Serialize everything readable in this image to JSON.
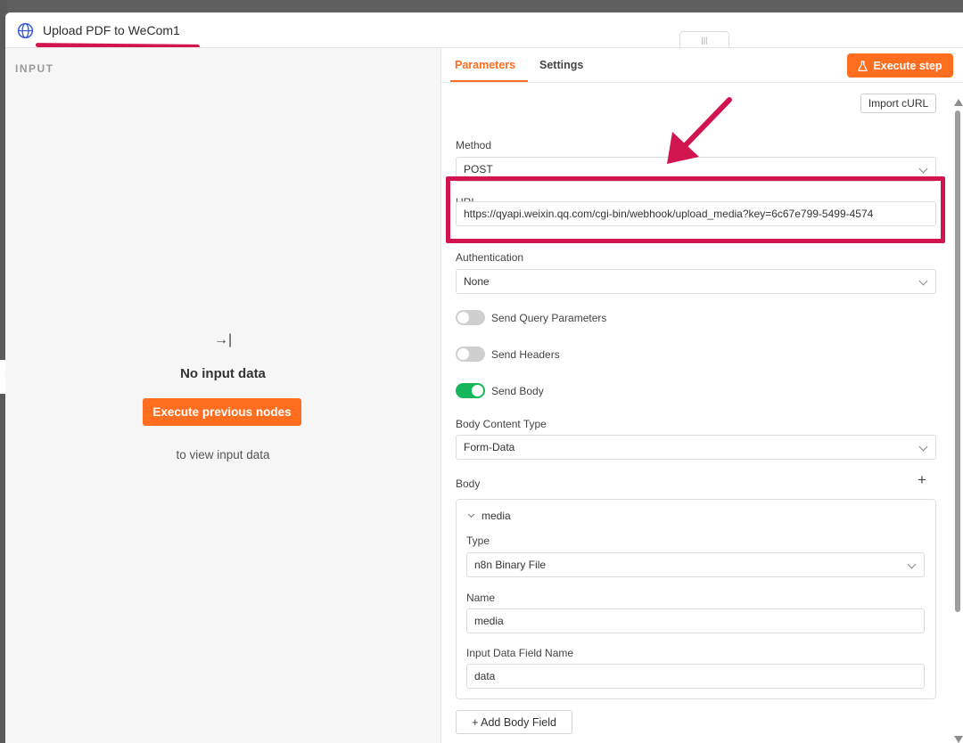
{
  "window": {
    "title": "Upload PDF to WeCom1",
    "handle_glyph": "|||"
  },
  "backdrop": {
    "tab_text": "{ }"
  },
  "input_panel": {
    "label": "INPUT",
    "empty_icon": "→|",
    "empty_title": "No input data",
    "execute_button": "Execute previous nodes",
    "hint": "to view input data"
  },
  "tabs": [
    {
      "label": "Parameters",
      "active": true
    },
    {
      "label": "Settings",
      "active": false
    }
  ],
  "execute_step": {
    "label": "Execute step",
    "icon": "flask-icon"
  },
  "import_curl": "Import cURL",
  "fields": {
    "method": {
      "label": "Method",
      "value": "POST"
    },
    "url": {
      "label": "URL",
      "value": "https://qyapi.weixin.qq.com/cgi-bin/webhook/upload_media?key=6c67e799-5499-4574"
    },
    "authentication": {
      "label": "Authentication",
      "value": "None"
    },
    "send_query": {
      "label": "Send Query Parameters",
      "on": false
    },
    "send_headers": {
      "label": "Send Headers",
      "on": false
    },
    "send_body": {
      "label": "Send Body",
      "on": true
    },
    "body_content_type": {
      "label": "Body Content Type",
      "value": "Form-Data"
    },
    "body": {
      "label": "Body",
      "add_icon": "+"
    }
  },
  "body_item": {
    "name": "media",
    "type_label": "Type",
    "type_value": "n8n Binary File",
    "name_label": "Name",
    "name_value": "media",
    "field_label": "Input Data Field Name",
    "field_value": "data"
  },
  "add_body_field": "+ Add Body Field",
  "colors": {
    "accent": "#ff6d1f",
    "toggle_on": "#15b75a",
    "annotation": "#d2154f"
  }
}
